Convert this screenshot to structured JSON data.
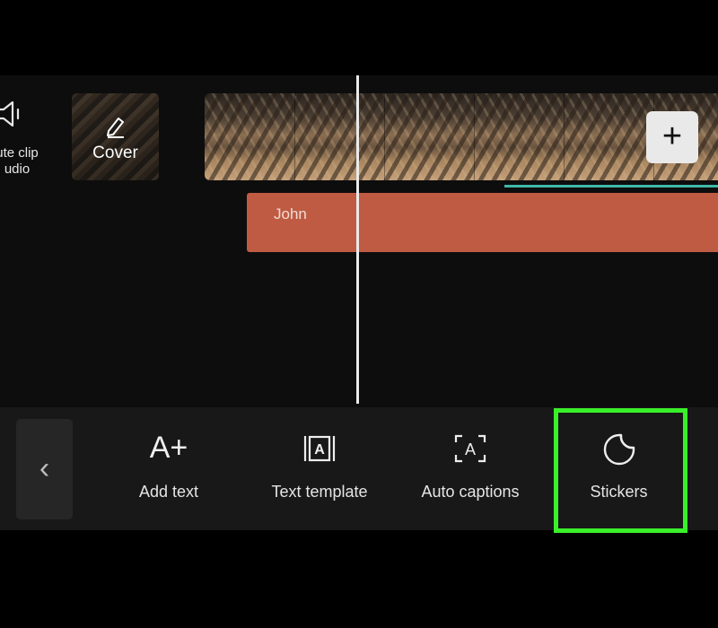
{
  "timeline": {
    "mute_clip_label": "ute clip\nudio",
    "cover_label": "Cover",
    "text_clip_label": "John",
    "add_clip_symbol": "+"
  },
  "toolbar": {
    "back_symbol": "‹",
    "tools": [
      {
        "label": "Add text",
        "icon": "add-text-icon"
      },
      {
        "label": "Text template",
        "icon": "text-template-icon"
      },
      {
        "label": "Auto captions",
        "icon": "auto-captions-icon"
      },
      {
        "label": "Stickers",
        "icon": "sticker-icon"
      }
    ],
    "add_text_glyph": "A+"
  },
  "colors": {
    "highlight": "#3af02b",
    "text_clip": "#bf5b43",
    "audio_line": "#3fb9a9"
  }
}
